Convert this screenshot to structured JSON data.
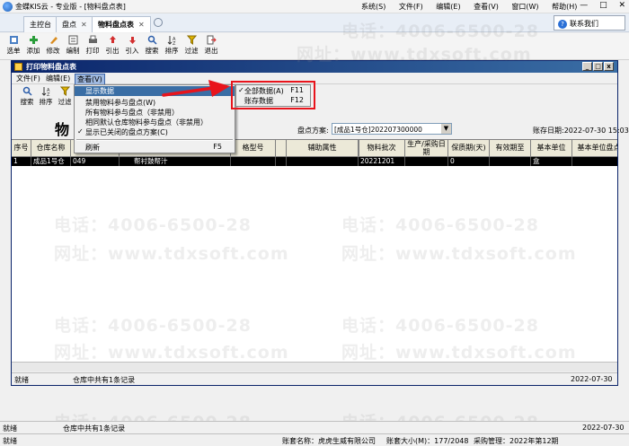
{
  "app": {
    "title": "金蝶KIS云 - 专业版 - [物料盘点表]",
    "menus": [
      "系统(S)",
      "文件(F)",
      "编辑(E)",
      "查看(V)",
      "窗口(W)",
      "帮助(H)"
    ],
    "win_controls": [
      "—",
      "□",
      "✕"
    ]
  },
  "tabs": [
    {
      "label": "主控台",
      "closable": false
    },
    {
      "label": "盘点",
      "closable": true
    },
    {
      "label": "物料盘点表",
      "closable": true,
      "active": true
    }
  ],
  "contact_button": "联系我们",
  "outer_toolbar": [
    {
      "label": "选单",
      "icon": "select-icon"
    },
    {
      "label": "添加",
      "icon": "add-icon"
    },
    {
      "label": "修改",
      "icon": "edit-icon"
    },
    {
      "label": "编制",
      "icon": "compile-icon"
    },
    {
      "label": "打印",
      "icon": "print-icon"
    },
    {
      "label": "引出",
      "icon": "export-icon"
    },
    {
      "label": "引入",
      "icon": "import-icon"
    },
    {
      "label": "搜索",
      "icon": "search-icon"
    },
    {
      "label": "排序",
      "icon": "sort-icon"
    },
    {
      "label": "过滤",
      "icon": "filter-icon"
    },
    {
      "label": "退出",
      "icon": "exit-icon"
    }
  ],
  "child_window": {
    "title": "打印物料盘点表",
    "controls": [
      "_",
      "□",
      "x"
    ],
    "menus": [
      "文件(F)",
      "编辑(E)",
      "查看(V)"
    ],
    "toolbar": [
      {
        "label": "搜索",
        "icon": "search-icon"
      },
      {
        "label": "排序",
        "icon": "sort-icon"
      },
      {
        "label": "过滤",
        "icon": "filter-icon"
      }
    ],
    "report_title": "物",
    "plan_label": "盘点方案:",
    "plan_value": "[成品1号仓]202207300000",
    "acct_date_label": "账存日期:",
    "acct_date_value": "2022-07-30 15:03",
    "table": {
      "headers": [
        "序号",
        "仓库名称",
        "",
        "",
        "格型号",
        "",
        "辅助属性",
        "",
        "物料批次",
        "生产/采购日期",
        "保质期(天)",
        "有效期至",
        "基本单位",
        "基本单位盘点"
      ],
      "rows": [
        [
          "1",
          "成品1号仓",
          "049",
          "帮衬鼓帮汁",
          "",
          "",
          "",
          "",
          "20221201",
          "",
          "0",
          "",
          "盒",
          ""
        ]
      ]
    },
    "status_left": "就绪",
    "status_mid": "仓库中共有1条记录",
    "status_right": "2022-07-30"
  },
  "dropdown": {
    "items": [
      {
        "label": "显示数据",
        "shortcut": "",
        "highlighted": true,
        "checked": false
      },
      {
        "label": "禁用物料参与盘点(W)",
        "shortcut": "",
        "highlighted": false,
        "checked": false
      },
      {
        "label": "所有物料参与盘点（非禁用）",
        "shortcut": "",
        "highlighted": false,
        "checked": false
      },
      {
        "label": "相同默认仓库物料参与盘点（非禁用）",
        "shortcut": "",
        "highlighted": false,
        "checked": false
      },
      {
        "label": "显示已关闭的盘点方案(C)",
        "shortcut": "",
        "highlighted": false,
        "checked": true
      },
      {
        "label": "刷新",
        "shortcut": "F5",
        "highlighted": false,
        "checked": false
      }
    ],
    "submenu": [
      {
        "label": "全部数据(A)",
        "shortcut": "F11",
        "checked": true
      },
      {
        "label": "账存数据",
        "shortcut": "F12",
        "checked": false
      }
    ],
    "arrow_color": "#e8141c"
  },
  "outer_status": {
    "line1_left": "就绪",
    "line1_mid": "仓库中共有1条记录",
    "line1_right": "2022-07-30",
    "line2_left": "就绪",
    "acct_name": "账套名称：虎虎生威有限公司",
    "acct_size": "账套大小(M)：177/2048",
    "purchase": "采购管理：2022年第12期"
  },
  "watermark": {
    "phone": "电话：4006-6500-28",
    "site": "网址：www.tdxsoft.com"
  }
}
